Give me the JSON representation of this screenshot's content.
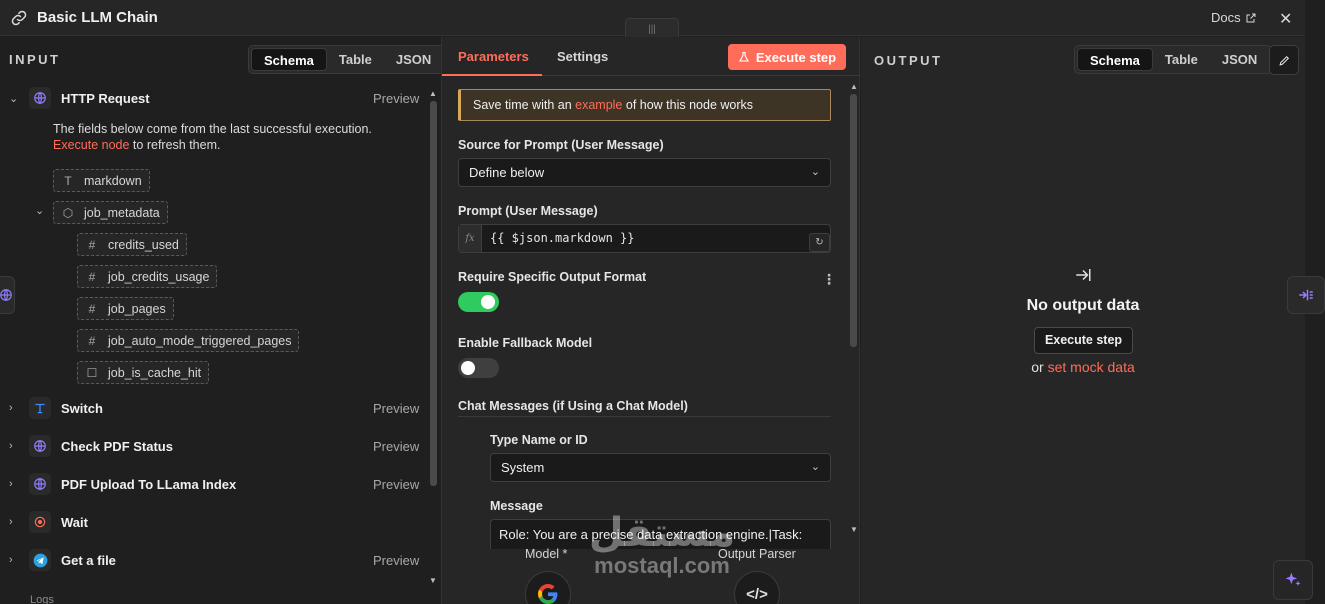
{
  "window": {
    "title": "Basic LLM Chain",
    "docs_label": "Docs",
    "close_glyph": "✕",
    "drag_glyph": "|||"
  },
  "input": {
    "label": "INPUT",
    "view_tabs": [
      "Schema",
      "Table",
      "JSON"
    ],
    "active_view": "Schema",
    "info_line1": "The fields below come from the last successful execution.",
    "info_link": "Execute node",
    "info_line2": " to refresh them.",
    "nodes": [
      {
        "name": "HTTP Request",
        "preview": "Preview",
        "icon": "globe-icon",
        "expanded": true
      },
      {
        "name": "Switch",
        "preview": "Preview",
        "icon": "switch-icon",
        "expanded": false
      },
      {
        "name": "Check PDF Status",
        "preview": "Preview",
        "icon": "globe-icon",
        "expanded": false
      },
      {
        "name": "PDF Upload To LLama Index",
        "preview": "Preview",
        "icon": "globe-icon",
        "expanded": false
      },
      {
        "name": "Wait",
        "preview": "",
        "icon": "wait-icon",
        "expanded": false
      },
      {
        "name": "Get a file",
        "preview": "Preview",
        "icon": "telegram-icon",
        "expanded": false
      }
    ],
    "fields": [
      {
        "name": "markdown",
        "type": "T"
      },
      {
        "name": "job_metadata",
        "type": "⬡"
      },
      {
        "name": "credits_used",
        "type": "#"
      },
      {
        "name": "job_credits_usage",
        "type": "#"
      },
      {
        "name": "job_pages",
        "type": "#"
      },
      {
        "name": "job_auto_mode_triggered_pages",
        "type": "#"
      },
      {
        "name": "job_is_cache_hit",
        "type": "☐"
      }
    ]
  },
  "params": {
    "tabs": [
      "Parameters",
      "Settings"
    ],
    "active_tab": "Parameters",
    "execute_label": "Execute step",
    "banner_pre": "Save time with an ",
    "banner_link": "example",
    "banner_post": " of how this node works",
    "source_label": "Source for Prompt (User Message)",
    "source_value": "Define below",
    "prompt_label": "Prompt (User Message)",
    "prompt_fx": "fx",
    "prompt_value": "{{ $json.markdown }}",
    "require_label": "Require Specific Output Format",
    "require_on": true,
    "fallback_label": "Enable Fallback Model",
    "fallback_on": false,
    "chat_label": "Chat Messages (if Using a Chat Model)",
    "type_label": "Type Name or ID",
    "type_value": "System",
    "message_label": "Message",
    "message_value": "Role: You are a precise data extraction engine.|Task:",
    "model_label": "Model *",
    "parser_label": "Output Parser"
  },
  "output": {
    "label": "OUTPUT",
    "view_tabs": [
      "Schema",
      "Table",
      "JSON"
    ],
    "active_view": "Schema",
    "empty_title": "No output data",
    "execute_label": "Execute step",
    "or_text": "or ",
    "mock_link": "set mock data"
  },
  "footer": {
    "logs": "Logs"
  },
  "watermark": {
    "arabic": "مستقل",
    "latin": "mostaql.com"
  },
  "colors": {
    "accent": "#ff6d5a",
    "toggle_on": "#2fcb5e",
    "toggle_off": "#3f3f3f",
    "ai": "#9b7bff"
  }
}
